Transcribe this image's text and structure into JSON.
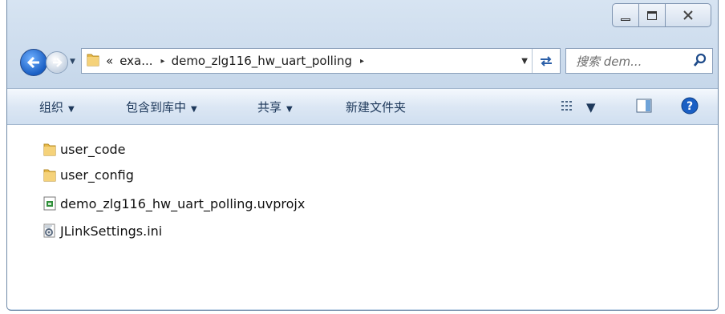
{
  "window": {
    "caption_buttons": {
      "minimize": "minimize-icon",
      "maximize": "maximize-icon",
      "close": "close-icon"
    },
    "close_glyph": "☒"
  },
  "nav": {
    "back_icon": "back-arrow-icon",
    "forward_icon": "forward-arrow-icon"
  },
  "address": {
    "overflow": "«",
    "crumbs": [
      "exa...",
      "demo_zlg116_hw_uart_polling"
    ],
    "separator": "▸"
  },
  "search": {
    "placeholder": "搜索 dem..."
  },
  "toolbar": {
    "organize": "组织",
    "include_in_library": "包含到库中",
    "share": "共享",
    "new_folder": "新建文件夹",
    "dropdown": "▼"
  },
  "files": [
    {
      "name": "user_code",
      "type": "folder"
    },
    {
      "name": "user_config",
      "type": "folder"
    },
    {
      "name": "demo_zlg116_hw_uart_polling.uvprojx",
      "type": "uvprojx"
    },
    {
      "name": "JLinkSettings.ini",
      "type": "ini"
    }
  ],
  "colors": {
    "folder": "#e8b949",
    "accent": "#1a5fc4"
  }
}
